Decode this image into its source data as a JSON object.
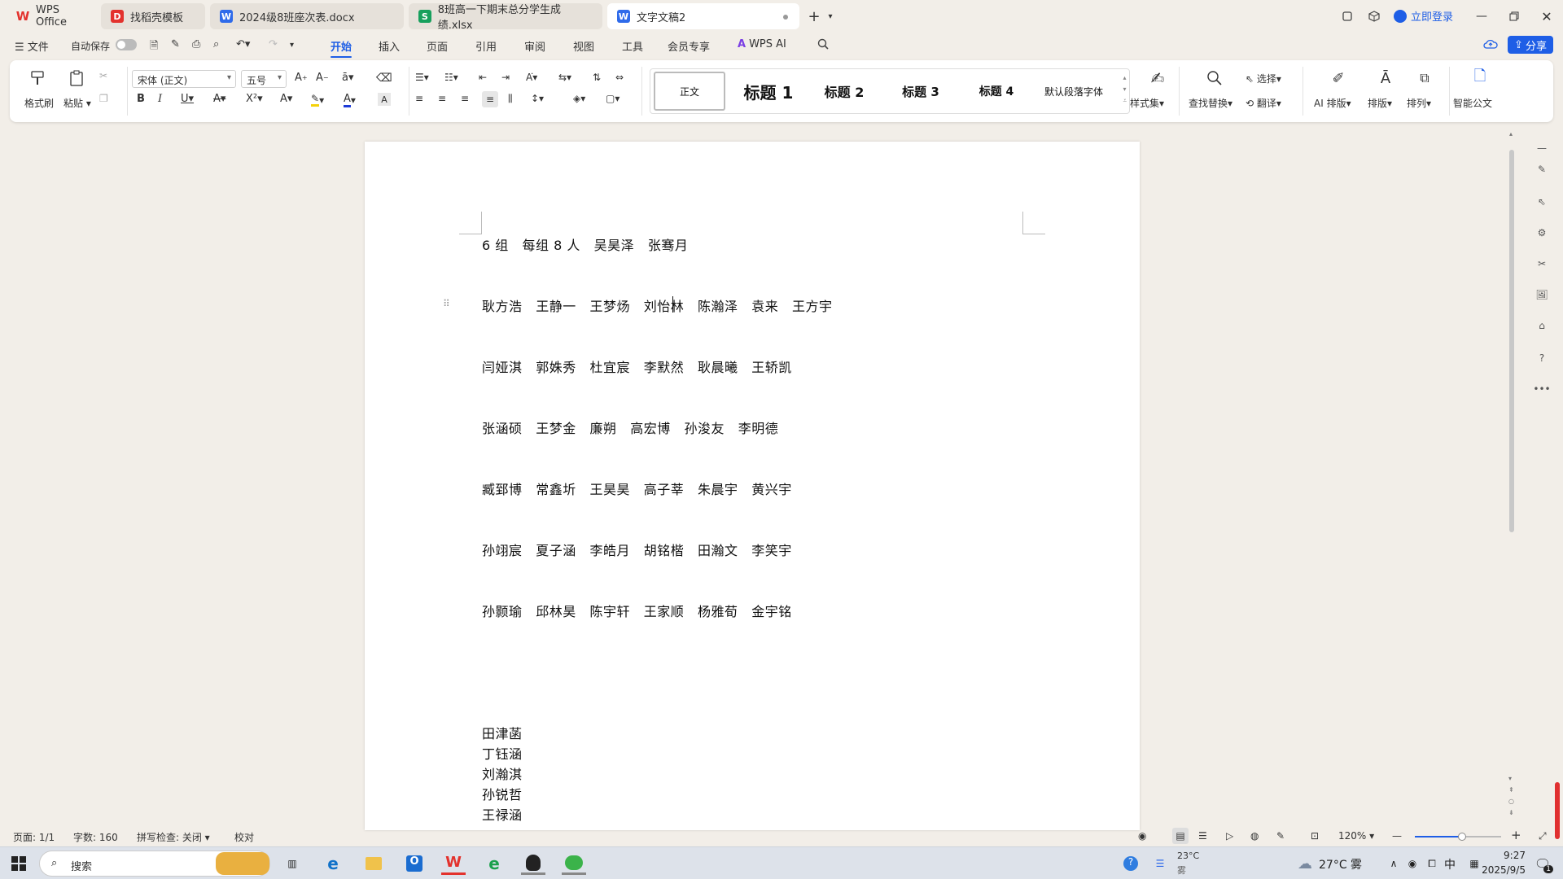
{
  "tabs": [
    {
      "label": "WPS Office",
      "icon": "wps-logo-icon",
      "color": "#e3322d"
    },
    {
      "label": "找稻壳模板",
      "icon": "docer-icon",
      "color": "#e3322d"
    },
    {
      "label": "2024级8班座次表.docx",
      "icon": "word-doc-icon",
      "color": "#2f6bea"
    },
    {
      "label": "8班高一下期末总分学生成绩.xlsx",
      "icon": "sheet-icon",
      "color": "#17a05d"
    },
    {
      "label": "文字文稿2",
      "icon": "word-doc-icon",
      "color": "#2f6bea",
      "active": true
    }
  ],
  "titlebar": {
    "login_label": "立即登录"
  },
  "menubar": {
    "file": "文件",
    "autosave": "自动保存",
    "items": [
      "开始",
      "插入",
      "页面",
      "引用",
      "审阅",
      "视图",
      "工具",
      "会员专享",
      "WPS AI"
    ],
    "share": "分享"
  },
  "ribbon": {
    "format_painter": "格式刷",
    "paste": "粘贴",
    "font_name": "宋体 (正文)",
    "font_size": "五号",
    "styles": [
      "正文",
      "标题 1",
      "标题 2",
      "标题 3",
      "标题 4",
      "默认段落字体"
    ],
    "style_set": "样式集",
    "find_replace": "查找替换",
    "select": "选择",
    "translate": "翻译",
    "ai_layout": "AI 排版",
    "layout": "排版",
    "arrange": "排列",
    "smart_doc": "智能公文"
  },
  "document": {
    "lines": [
      "6 组   每组 8 人   吴昊泽   张骞月",
      "耿方浩   王静一   王梦炀   刘怡林   陈瀚泽   袁来   王方宇",
      "闫娅淇   郭姝秀   杜宜宸   李默然   耿晨曦   王轿凯",
      "张涵硕   王梦金   廉朔   高宏博   孙浚友   李明德",
      "臧郅博   常鑫圻   王昊昊   高子莘   朱晨宇   黄兴宇",
      "孙翊宸   夏子涵   李皓月   胡铭楷   田瀚文   李笑宇",
      "孙颢瑜   邱林昊   陈宇轩   王家顺   杨雅荀   金宇铭"
    ],
    "list": [
      "田津菡",
      "丁钰涵",
      "刘瀚淇",
      "孙锐哲",
      "王禄涵"
    ]
  },
  "statusbar": {
    "page": "页面: 1/1",
    "words": "字数: 160",
    "spellcheck": "拼写检查: 关闭",
    "proofread": "校对",
    "zoom": "120%",
    "zoom_level": 0.55
  },
  "taskbar": {
    "search": "搜索",
    "weather_temp_small": "23°C",
    "weather_desc_small": "雾",
    "weather_temp": "27°C",
    "weather_desc": "雾",
    "ime": "中",
    "time": "9:27",
    "date": "2025/9/5",
    "notifications": "1"
  }
}
